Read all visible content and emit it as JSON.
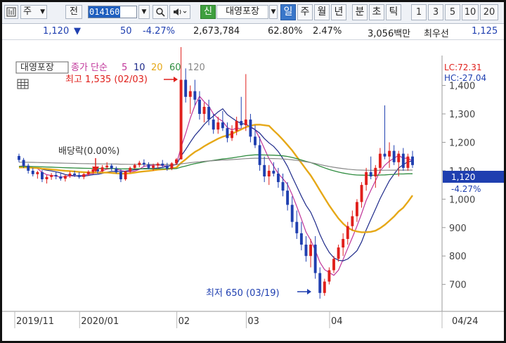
{
  "toolbar": {
    "icon_left": "chart-icon",
    "market_select": "주",
    "category_label": "전",
    "stock_code": "014160",
    "new_badge": "신",
    "stock_name": "대영포장",
    "periods": [
      "일",
      "주",
      "월",
      "년",
      "분",
      "초",
      "틱"
    ],
    "selected_period": "일",
    "intervals": [
      "1",
      "3",
      "5",
      "10",
      "20"
    ]
  },
  "info": {
    "price": "1,120",
    "change_arrow": "▼",
    "change": "50",
    "change_pct": "-4.27%",
    "volume": "2,673,784",
    "volume_ratio": "62.80%",
    "turnover": "2.47%",
    "amount": "3,056백만",
    "preferred": "최우선",
    "pref_price": "1,125"
  },
  "chart": {
    "legend_stock": "대영포장",
    "legend_ma_label": "종가 단순",
    "legend_ma": [
      {
        "label": "5",
        "color": "#c0359a"
      },
      {
        "label": "10",
        "color": "#1e2a8a"
      },
      {
        "label": "20",
        "color": "#e6a817"
      },
      {
        "label": "60",
        "color": "#2e8b3e"
      },
      {
        "label": "120",
        "color": "#888888"
      }
    ],
    "lc": "LC:72.31",
    "hc": "HC:-27.04",
    "price_label": "1,120",
    "price_change_label": "-4.27%",
    "high_annotation": "최고 1,535 (02/03)",
    "low_annotation": "최저 650 (03/19)",
    "dividend_annotation": "배당락(0.00%)",
    "colors": {
      "up": "#e0201c",
      "down": "#1f3fb0",
      "ma5": "#c0359a",
      "ma10": "#1e2a8a",
      "ma20": "#e6a817",
      "ma60": "#2e8b3e",
      "ma120": "#888888"
    }
  },
  "chart_data": {
    "type": "candlestick",
    "y_ticks": [
      "1,400",
      "1,300",
      "1,200",
      "1,100",
      "1,000",
      "900",
      "800",
      "700"
    ],
    "x_ticks": [
      "2019/11",
      "2020/01",
      "02",
      "03",
      "04",
      "04/24"
    ],
    "ylim": [
      620,
      1540
    ],
    "ohlc": [
      [
        1152,
        1160,
        1130,
        1138
      ],
      [
        1138,
        1145,
        1110,
        1118
      ],
      [
        1118,
        1125,
        1090,
        1100
      ],
      [
        1100,
        1110,
        1080,
        1088
      ],
      [
        1088,
        1100,
        1072,
        1095
      ],
      [
        1095,
        1102,
        1060,
        1070
      ],
      [
        1070,
        1085,
        1055,
        1078
      ],
      [
        1078,
        1092,
        1068,
        1085
      ],
      [
        1085,
        1095,
        1070,
        1080
      ],
      [
        1080,
        1090,
        1065,
        1072
      ],
      [
        1072,
        1086,
        1062,
        1082
      ],
      [
        1082,
        1098,
        1075,
        1090
      ],
      [
        1090,
        1100,
        1078,
        1085
      ],
      [
        1085,
        1095,
        1072,
        1078
      ],
      [
        1078,
        1092,
        1070,
        1088
      ],
      [
        1088,
        1102,
        1082,
        1096
      ],
      [
        1096,
        1110,
        1088,
        1105
      ],
      [
        1105,
        1115,
        1090,
        1098
      ],
      [
        1098,
        1120,
        1095,
        1112
      ],
      [
        1112,
        1130,
        1105,
        1118
      ],
      [
        1118,
        1125,
        1100,
        1108
      ],
      [
        1108,
        1115,
        1090,
        1095
      ],
      [
        1095,
        1105,
        1060,
        1070
      ],
      [
        1070,
        1100,
        1065,
        1098
      ],
      [
        1098,
        1115,
        1092,
        1110
      ],
      [
        1110,
        1125,
        1105,
        1120
      ],
      [
        1120,
        1135,
        1112,
        1128
      ],
      [
        1128,
        1140,
        1115,
        1122
      ],
      [
        1122,
        1130,
        1105,
        1110
      ],
      [
        1110,
        1125,
        1100,
        1118
      ],
      [
        1118,
        1130,
        1108,
        1125
      ],
      [
        1125,
        1138,
        1112,
        1118
      ],
      [
        1118,
        1128,
        1100,
        1108
      ],
      [
        1108,
        1130,
        1102,
        1126
      ],
      [
        1126,
        1145,
        1120,
        1140
      ],
      [
        1140,
        1535,
        1140,
        1420
      ],
      [
        1420,
        1460,
        1340,
        1360
      ],
      [
        1360,
        1400,
        1300,
        1380
      ],
      [
        1380,
        1420,
        1330,
        1350
      ],
      [
        1350,
        1380,
        1280,
        1300
      ],
      [
        1300,
        1340,
        1270,
        1325
      ],
      [
        1325,
        1350,
        1260,
        1280
      ],
      [
        1280,
        1300,
        1230,
        1245
      ],
      [
        1245,
        1290,
        1230,
        1270
      ],
      [
        1270,
        1310,
        1240,
        1250
      ],
      [
        1250,
        1270,
        1200,
        1215
      ],
      [
        1215,
        1260,
        1205,
        1240
      ],
      [
        1240,
        1290,
        1225,
        1275
      ],
      [
        1275,
        1360,
        1250,
        1260
      ],
      [
        1260,
        1440,
        1240,
        1280
      ],
      [
        1280,
        1300,
        1200,
        1220
      ],
      [
        1220,
        1260,
        1180,
        1190
      ],
      [
        1190,
        1220,
        1100,
        1120
      ],
      [
        1120,
        1150,
        1060,
        1080
      ],
      [
        1080,
        1120,
        1050,
        1100
      ],
      [
        1100,
        1130,
        1080,
        1090
      ],
      [
        1090,
        1110,
        1040,
        1060
      ],
      [
        1060,
        1090,
        1010,
        1030
      ],
      [
        1030,
        1060,
        960,
        980
      ],
      [
        980,
        1010,
        900,
        920
      ],
      [
        920,
        960,
        860,
        880
      ],
      [
        880,
        920,
        820,
        840
      ],
      [
        840,
        870,
        780,
        800
      ],
      [
        800,
        860,
        760,
        840
      ],
      [
        840,
        870,
        720,
        740
      ],
      [
        740,
        760,
        650,
        670
      ],
      [
        670,
        720,
        660,
        710
      ],
      [
        710,
        760,
        700,
        750
      ],
      [
        750,
        800,
        740,
        790
      ],
      [
        790,
        840,
        780,
        830
      ],
      [
        830,
        880,
        800,
        860
      ],
      [
        860,
        920,
        840,
        905
      ],
      [
        905,
        960,
        890,
        940
      ],
      [
        940,
        1000,
        920,
        990
      ],
      [
        990,
        1060,
        970,
        1050
      ],
      [
        1050,
        1110,
        1030,
        1095
      ],
      [
        1095,
        1150,
        1070,
        1080
      ],
      [
        1080,
        1120,
        1040,
        1110
      ],
      [
        1110,
        1180,
        1090,
        1160
      ],
      [
        1160,
        1330,
        1140,
        1150
      ],
      [
        1150,
        1200,
        1110,
        1170
      ],
      [
        1170,
        1190,
        1120,
        1130
      ],
      [
        1130,
        1170,
        1080,
        1160
      ],
      [
        1160,
        1180,
        1100,
        1110
      ],
      [
        1110,
        1160,
        1100,
        1150
      ],
      [
        1150,
        1170,
        1110,
        1120
      ]
    ]
  }
}
